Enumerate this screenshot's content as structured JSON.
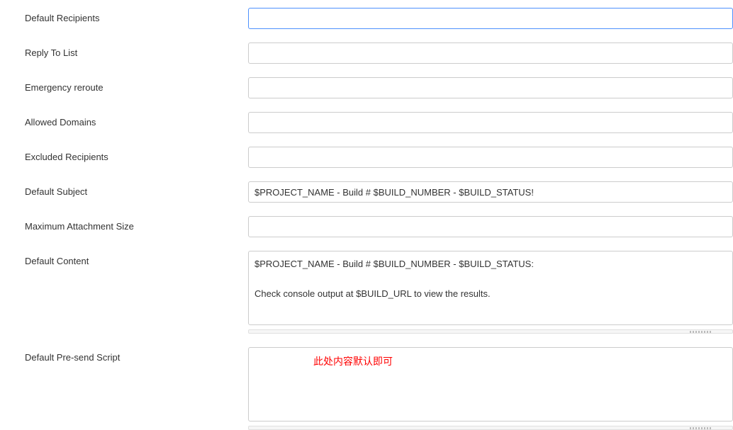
{
  "form": {
    "defaultRecipients": {
      "label": "Default Recipients",
      "value": ""
    },
    "replyToList": {
      "label": "Reply To List",
      "value": ""
    },
    "emergencyReroute": {
      "label": "Emergency reroute",
      "value": ""
    },
    "allowedDomains": {
      "label": "Allowed Domains",
      "value": ""
    },
    "excludedRecipients": {
      "label": "Excluded Recipients",
      "value": ""
    },
    "defaultSubject": {
      "label": "Default Subject",
      "value": "$PROJECT_NAME - Build # $BUILD_NUMBER - $BUILD_STATUS!"
    },
    "maximumAttachmentSize": {
      "label": "Maximum Attachment Size",
      "value": ""
    },
    "defaultContent": {
      "label": "Default Content",
      "value": "$PROJECT_NAME - Build # $BUILD_NUMBER - $BUILD_STATUS:\n\nCheck console output at $BUILD_URL to view the results."
    },
    "defaultPresendScript": {
      "label": "Default Pre-send Script",
      "value": ""
    }
  },
  "annotation": "此处内容默认即可"
}
